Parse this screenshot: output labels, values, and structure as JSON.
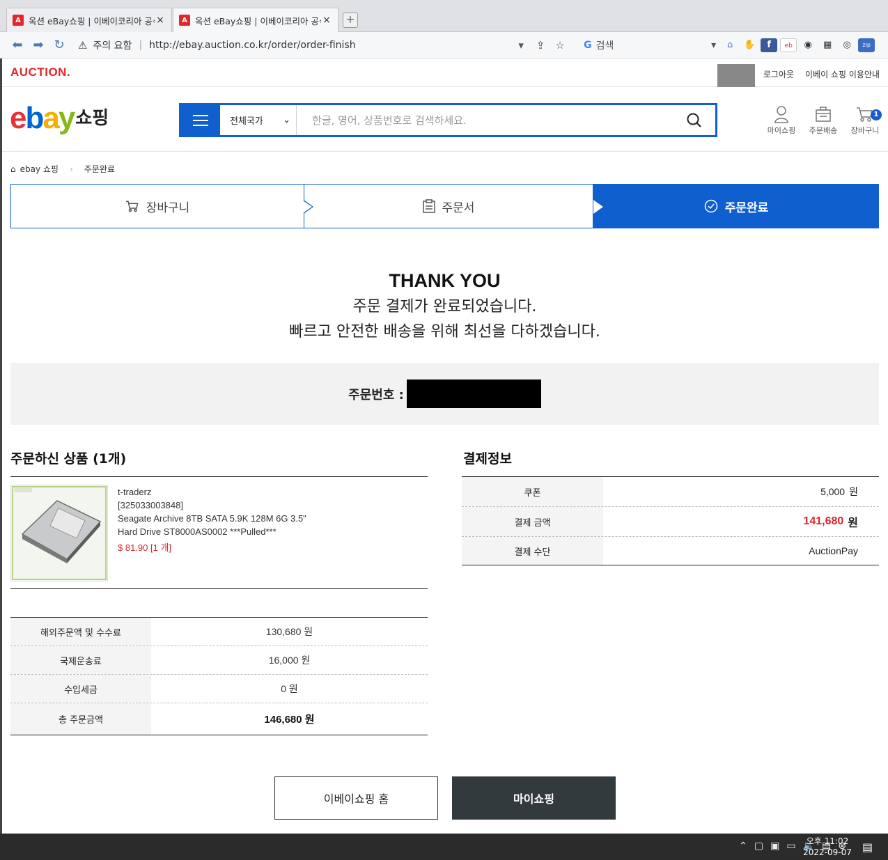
{
  "browser": {
    "tabs": [
      {
        "favicon": "A",
        "title": "옥션 eBay쇼핑 | 이베이코리아 공식",
        "close": "×"
      },
      {
        "favicon": "A",
        "title": "옥션 eBay쇼핑 | 이베이코리아 공식",
        "close": "×"
      }
    ],
    "new_tab": "+",
    "security_warning": "주의 요함",
    "url": "http://ebay.auction.co.kr/order/order-finish",
    "search_engine": "G",
    "search_placeholder": "검색"
  },
  "site": {
    "auction_logo": "AUCTION.",
    "util_links": [
      "로그아웃",
      "이베이 쇼핑 이용안내"
    ],
    "logo_suffix": "쇼핑",
    "country_select": "전체국가",
    "search_placeholder": "한글, 영어, 상품번호로 검색하세요.",
    "header_icons": [
      {
        "label": "마이쇼핑",
        "icon": "person-icon"
      },
      {
        "label": "주문배송",
        "icon": "box-icon"
      },
      {
        "label": "장바구니",
        "icon": "cart-icon",
        "badge": "1"
      }
    ]
  },
  "breadcrumb": {
    "home": "ebay 쇼핑",
    "current": "주문완료"
  },
  "steps": [
    {
      "label": "장바구니",
      "icon": "cart-icon",
      "active": false
    },
    {
      "label": "주문서",
      "icon": "clipboard-icon",
      "active": false
    },
    {
      "label": "주문완료",
      "icon": "check-circle-icon",
      "active": true
    }
  ],
  "thanks": {
    "heading": "THANK YOU",
    "line1": "주문 결제가 완료되었습니다.",
    "line2": "빠르고 안전한 배송을 위해 최선을 다하겠습니다."
  },
  "order_number_label": "주문번호 :",
  "products_section": {
    "title": "주문하신 상품 (1개)",
    "items": [
      {
        "seller": "t-traderz",
        "item_id": "[325033003848]",
        "name_line1": "Seagate Archive 8TB SATA 5.9K 128M 6G 3.5\"",
        "name_line2": "Hard Drive ST8000AS0002 ***Pulled***",
        "price": "$ 81.90 [1 개]"
      }
    ]
  },
  "fees": [
    {
      "label": "해외주문액 및 수수료",
      "value": "130,680 원"
    },
    {
      "label": "국제운송료",
      "value": "16,000 원"
    },
    {
      "label": "수입세금",
      "value": "0 원"
    },
    {
      "label": "총 주문금액",
      "value": "146,680 원"
    }
  ],
  "payment_section": {
    "title": "결제정보",
    "rows": [
      {
        "label": "쿠폰",
        "amount": "5,000",
        "unit": "원"
      },
      {
        "label": "결제 금액",
        "amount": "141,680",
        "unit": "원"
      },
      {
        "label": "결제 수단",
        "amount": "AuctionPay",
        "unit": ""
      }
    ]
  },
  "buttons": {
    "home": "이베이쇼핑 홈",
    "myshopping": "마이쇼핑"
  },
  "taskbar": {
    "time": "오후 11:02",
    "date": "2022-09-07"
  },
  "colors": {
    "primary": "#0f5fce",
    "accent_red": "#d8262c",
    "dark_button": "#333a3e"
  }
}
